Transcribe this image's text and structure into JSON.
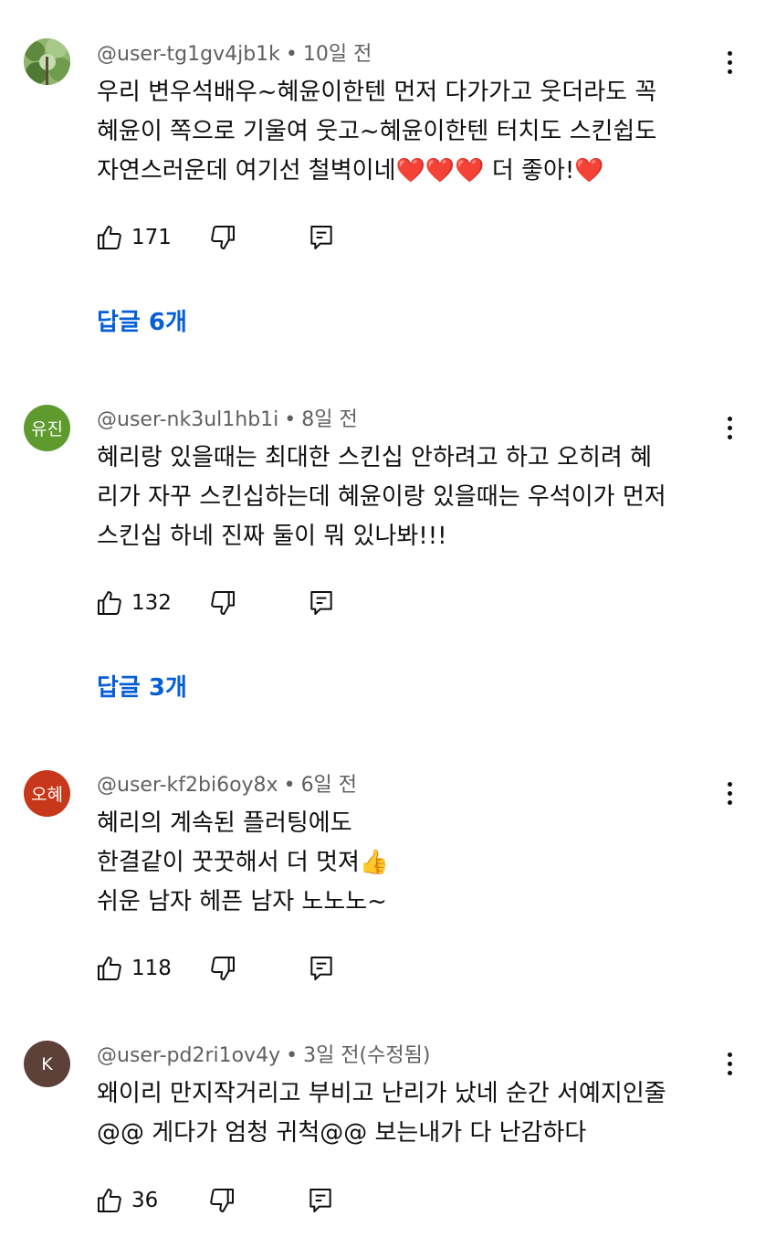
{
  "colors": {
    "link": "#065fd4",
    "meta": "#606060",
    "text": "#0f0f0f"
  },
  "comments": [
    {
      "author": "@user-tg1gv4jb1k",
      "time": "10일 전",
      "avatar": {
        "type": "image",
        "label": "",
        "color": "#7aa05a",
        "icon": "nature-photo-avatar"
      },
      "text": "우리 변우석배우~혜윤이한텐 먼저 다가가고 웃더라도 꼭\n혜윤이 쪽으로 기울여 웃고~혜윤이한텐 터치도 스킨쉽도\n자연스러운데 여기선 철벽이네❤️❤️❤️ 더 좋아!❤️",
      "likes": "171",
      "replies": "답글 6개"
    },
    {
      "author": "@user-nk3ul1hb1i",
      "time": "8일 전",
      "avatar": {
        "type": "text",
        "label": "유진",
        "color": "#5e9a2d"
      },
      "text": "혜리랑 있을때는 최대한 스킨십 안하려고 하고 오히려 혜\n리가 자꾸 스킨십하는데 혜윤이랑 있을때는 우석이가 먼저\n스킨십 하네 진짜 둘이 뭐 있나봐!!!",
      "likes": "132",
      "replies": "답글 3개"
    },
    {
      "author": "@user-kf2bi6oy8x",
      "time": "6일 전",
      "avatar": {
        "type": "text",
        "label": "오혜",
        "color": "#c7371a"
      },
      "text": "혜리의 계속된 플러팅에도\n한결같이 꿋꿋해서 더 멋져👍\n쉬운 남자 헤픈 남자 노노노~",
      "likes": "118",
      "replies": ""
    },
    {
      "author": "@user-pd2ri1ov4y",
      "time": "3일 전(수정됨)",
      "avatar": {
        "type": "text",
        "label": "K",
        "color": "#5d4037"
      },
      "text": "왜이리 만지작거리고 부비고 난리가 났네 순간 서예지인줄\n@@ 게다가 엄청 귀척@@ 보는내가 다 난감하다",
      "likes": "36",
      "replies": ""
    }
  ]
}
